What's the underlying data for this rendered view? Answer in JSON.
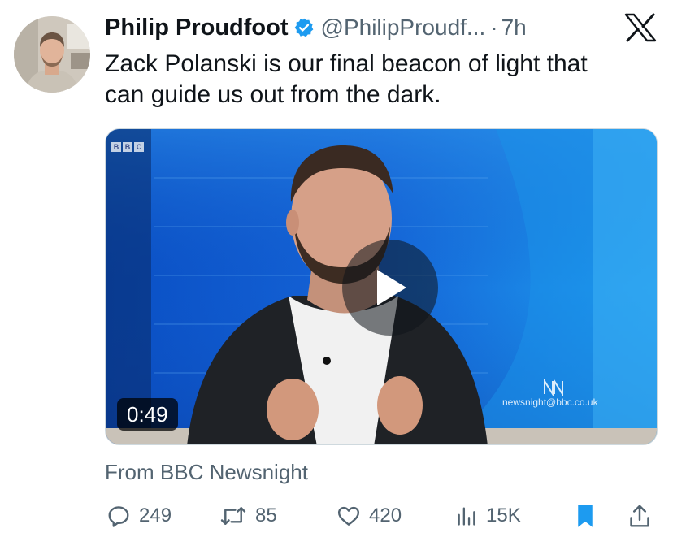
{
  "author": {
    "name": "Philip Proudfoot",
    "handle": "@PhilipProudf...",
    "separator": "·",
    "time": "7h",
    "verified": true
  },
  "tweet": {
    "text": "Zack Polanski is our final beacon of light that\ncan guide us out from the dark."
  },
  "media": {
    "duration": "0:49",
    "watermark_letters": [
      "B",
      "B",
      "C"
    ],
    "studio_email": "newsnight@bbc.co.uk",
    "play_icon": "play-icon"
  },
  "source": {
    "text": "From BBC Newsnight"
  },
  "actions": {
    "replies": "249",
    "retweets": "85",
    "likes": "420",
    "views": "15K"
  },
  "colors": {
    "text": "#0f1419",
    "secondary": "#536471",
    "accent": "#1d9bf0",
    "verified": "#1d9bf0"
  }
}
